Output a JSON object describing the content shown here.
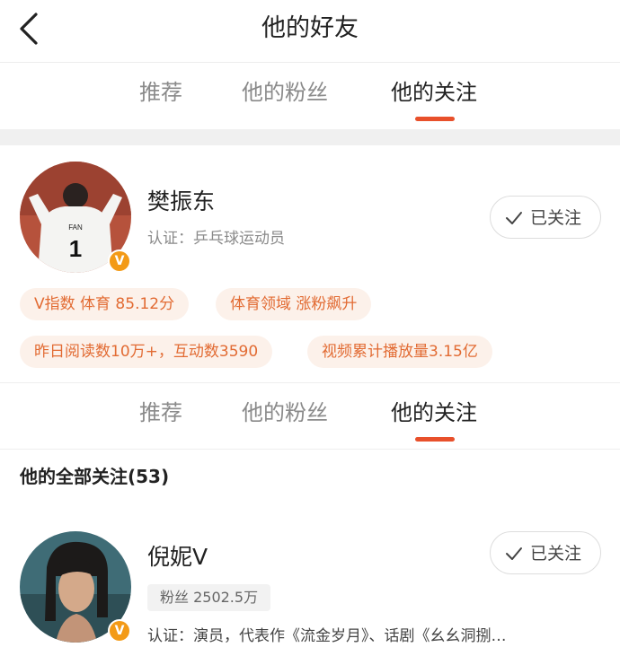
{
  "header": {
    "title": "他的好友"
  },
  "tabs": [
    {
      "label": "推荐"
    },
    {
      "label": "他的粉丝"
    },
    {
      "label": "他的关注"
    }
  ],
  "active_tab": "他的关注",
  "profile": {
    "name": "樊振东",
    "cert": "认证：乒乓球运动员",
    "follow_label": "已关注",
    "jersey_text": "FAN",
    "jersey_number": "1",
    "stats": [
      "V指数 体育 85.12分",
      "体育领域 涨粉飙升",
      "昨日阅读数10万+，互动数3590",
      "视频累计播放量3.15亿"
    ]
  },
  "following": {
    "title": "他的全部关注(53)",
    "items": [
      {
        "name": "倪妮V",
        "fans": "粉丝 2502.5万",
        "cert": "认证：演员，代表作《流金岁月》、话剧《幺幺洞捌…",
        "follow_label": "已关注"
      }
    ]
  },
  "colors": {
    "accent": "#e8502b",
    "verified_badge": "#f39a16",
    "pill_text": "#e26b33",
    "pill_bg": "#fcf1ea"
  }
}
